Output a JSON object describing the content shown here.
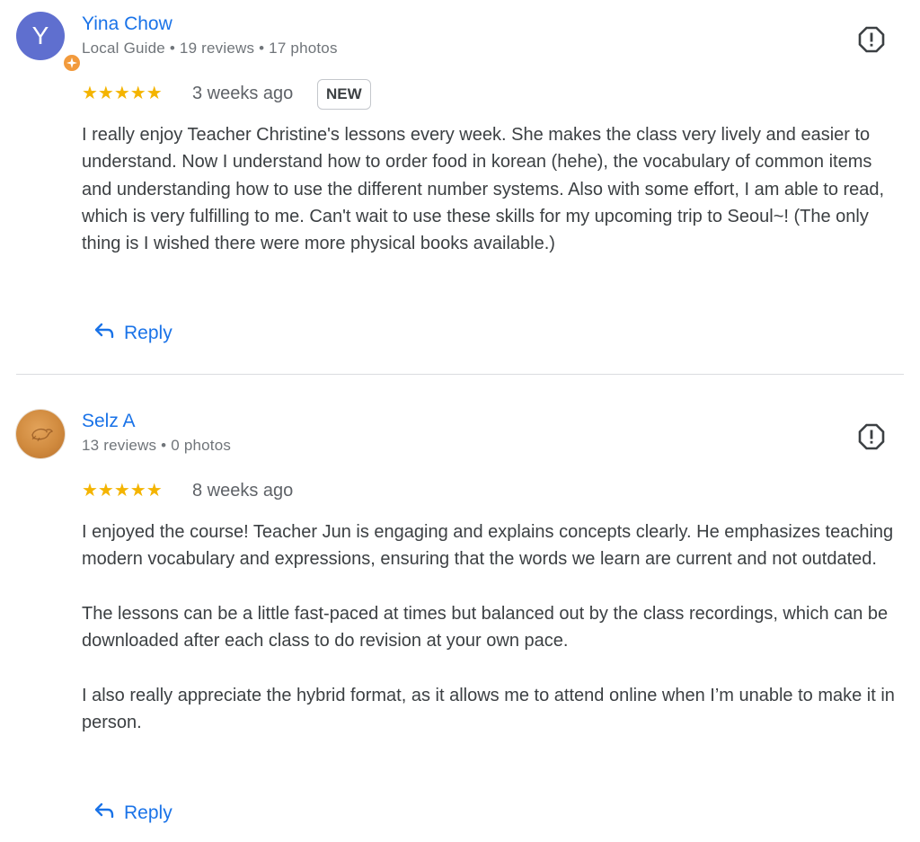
{
  "reviews": [
    {
      "author": "Yina Chow",
      "avatar_letter": "Y",
      "avatar_color": "#5f6fcf",
      "local_guide_badge": "star-badge-icon",
      "meta": "Local Guide • 19 reviews • 17 photos",
      "rating": 5,
      "stars": "★★★★★",
      "date": "3 weeks ago",
      "badge": "NEW",
      "paragraphs": [
        "I really enjoy Teacher Christine's lessons every week. She makes the class very lively and easier to understand. Now I understand how to order food in korean (hehe), the vocabulary of common items and understanding how to use the different number systems. Also with some effort, I am able to read, which is very fulfilling to me. Can't wait to use these skills for my upcoming trip to Seoul~! (The only thing is I wished there were more physical books available.)"
      ],
      "reply_label": "Reply"
    },
    {
      "author": "Selz A",
      "avatar_icon": "bird-photo-avatar",
      "meta": "13 reviews • 0 photos",
      "rating": 5,
      "stars": "★★★★★",
      "date": "8 weeks ago",
      "paragraphs": [
        "I enjoyed the course! Teacher Jun is engaging and explains concepts clearly. He emphasizes teaching modern vocabulary and expressions, ensuring that the words we learn are current and not outdated.",
        "The lessons can be a little fast-paced at times but balanced out by the class recordings, which can be downloaded after each class to do revision at your own pace.",
        "I also really appreciate the hybrid format, as it allows me to attend online when I’m unable to make it in person."
      ],
      "reply_label": "Reply"
    }
  ],
  "colors": {
    "link": "#1a73e8",
    "star": "#f4b400",
    "text": "#3c4043",
    "meta": "#70757a",
    "divider": "#dadce0"
  },
  "icons": {
    "report": "report-flag-icon",
    "reply": "reply-arrow-icon"
  }
}
